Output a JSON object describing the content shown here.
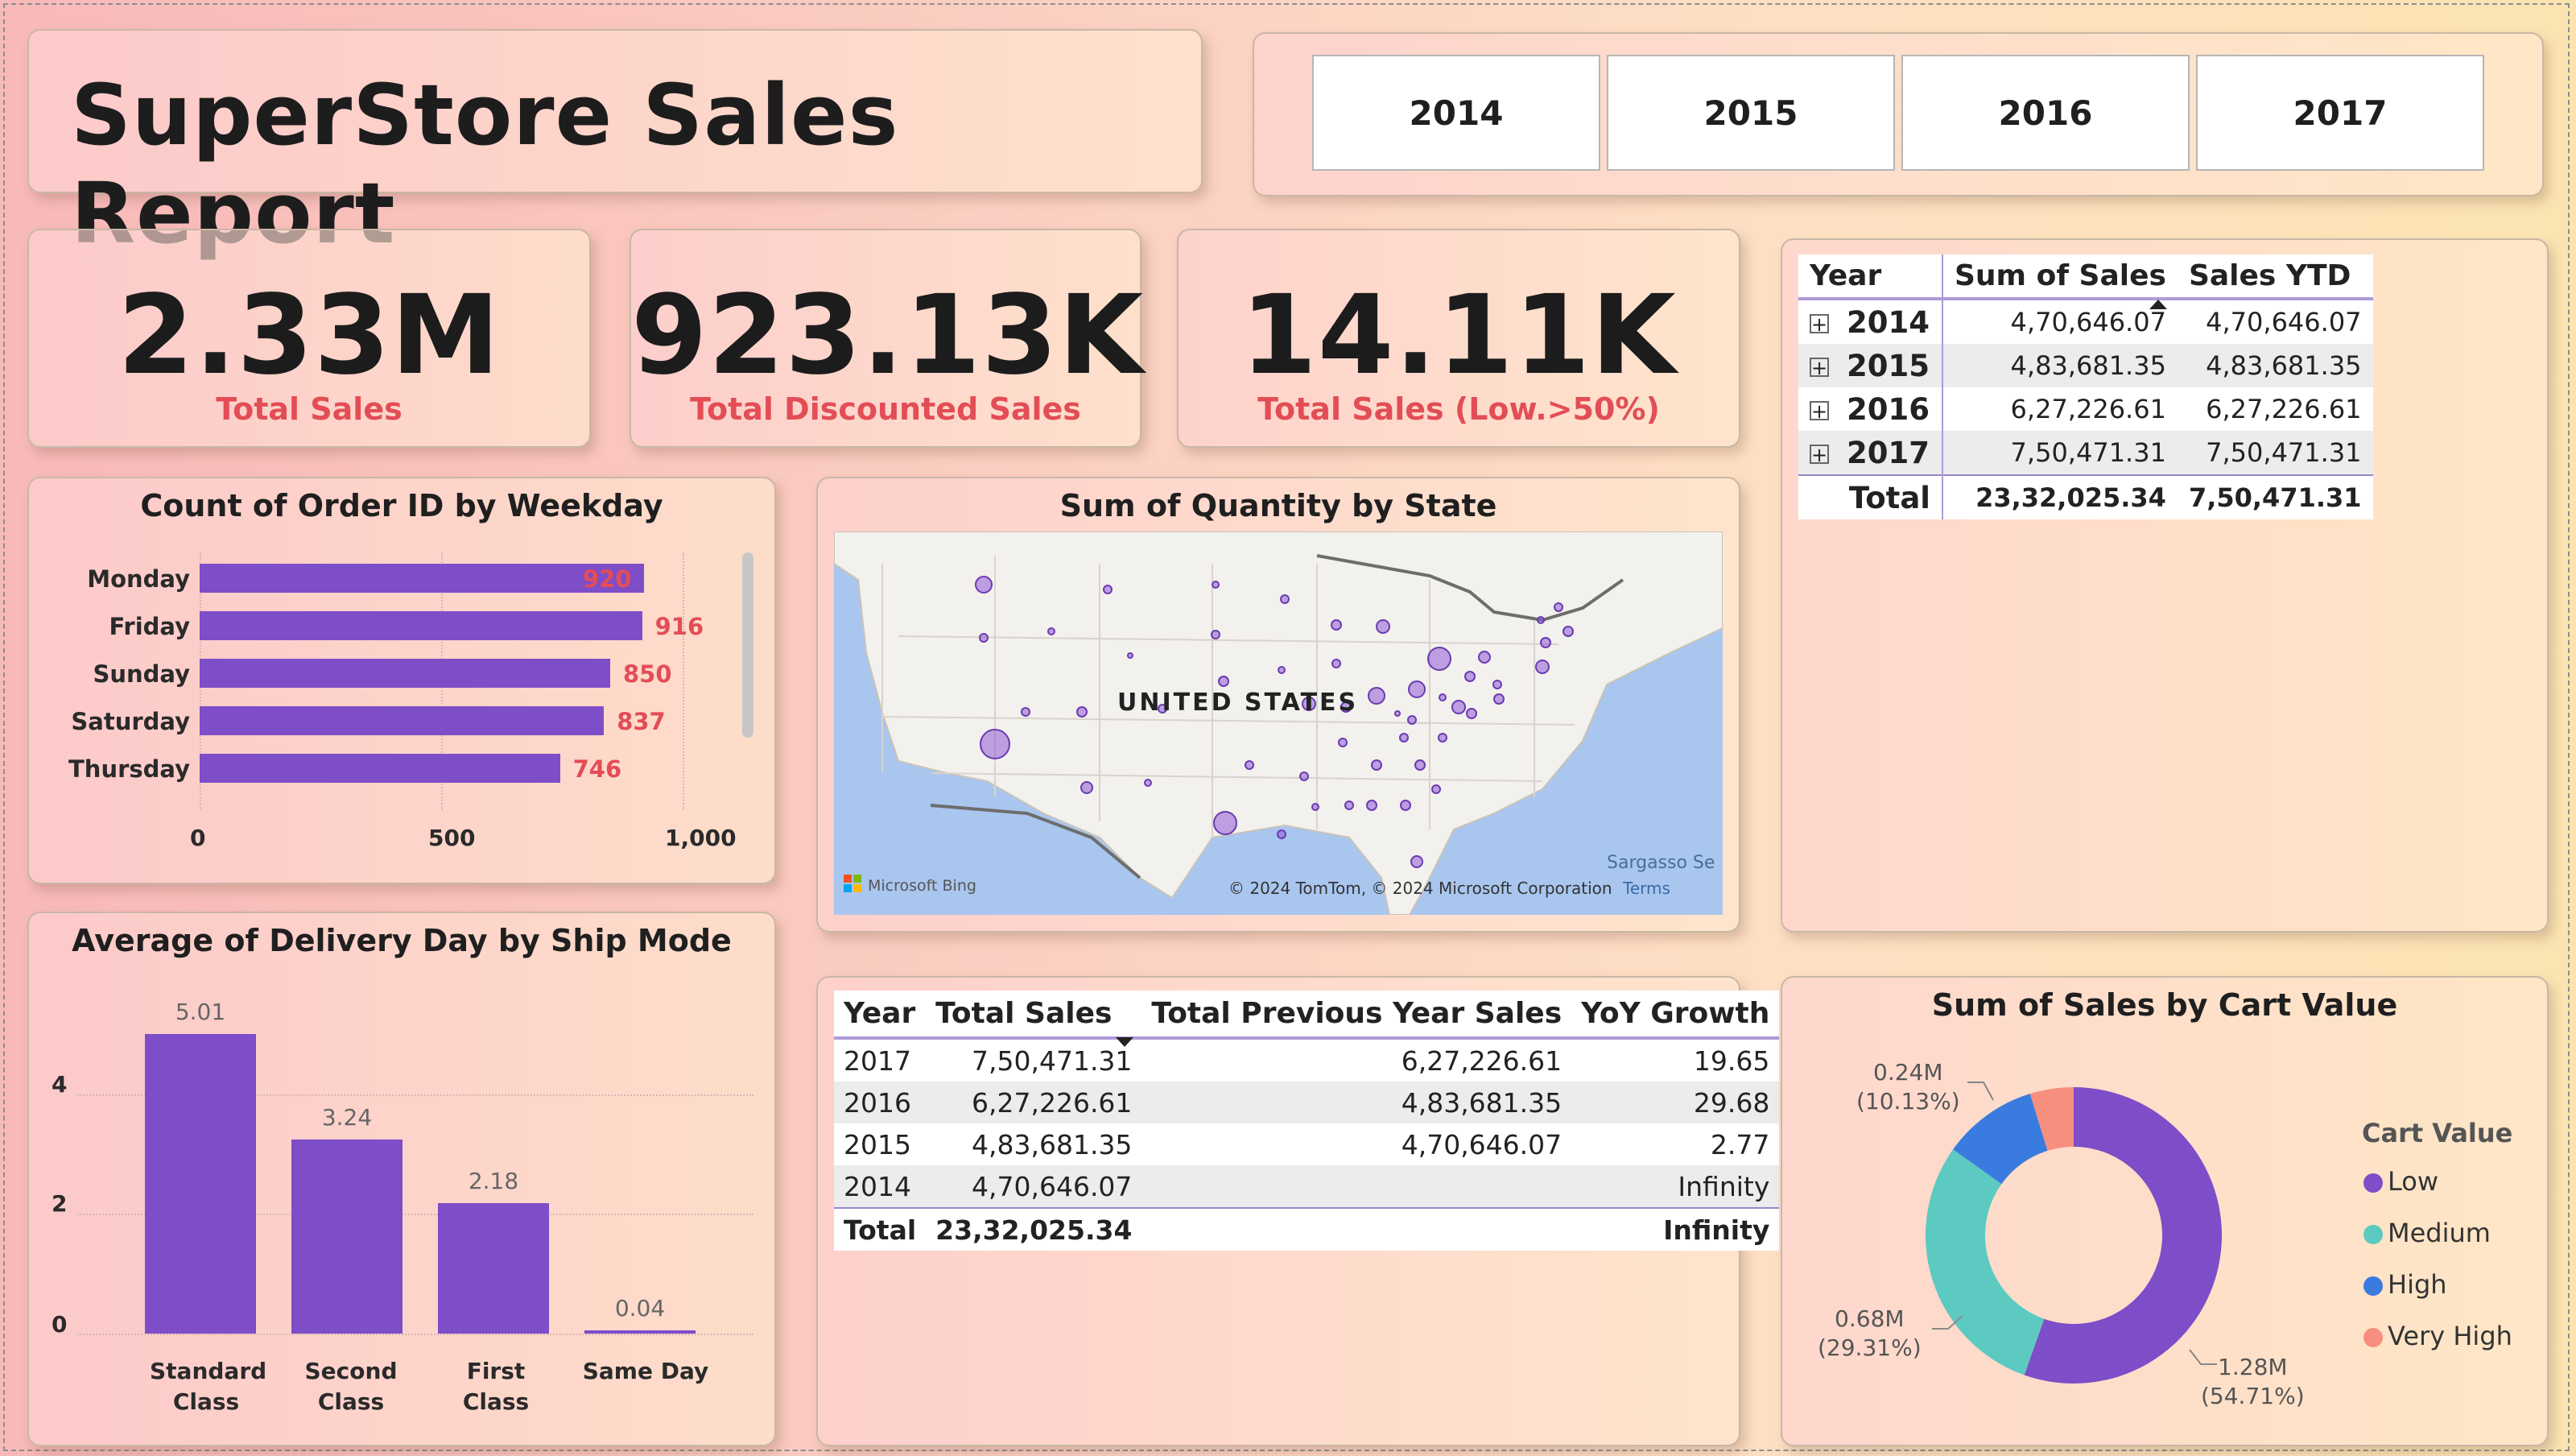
{
  "header": {
    "title": "SuperStore Sales Report"
  },
  "slicer": {
    "years": [
      "2014",
      "2015",
      "2016",
      "2017"
    ]
  },
  "kpis": [
    {
      "value": "2.33M",
      "label": "Total Sales"
    },
    {
      "value": "923.13K",
      "label": "Total Discounted Sales"
    },
    {
      "value": "14.11K",
      "label": "Total Sales (Low.>50%)"
    }
  ],
  "weekday_chart": {
    "title": "Count of Order ID by Weekday",
    "ticks": [
      "0",
      "500",
      "1,000"
    ]
  },
  "map": {
    "title": "Sum of Quantity by State",
    "country_label": "UNITED STATES",
    "bing": "Microsoft Bing",
    "sea_label": "Sargasso Se",
    "copyright": "© 2024 TomTom, © 2024 Microsoft Corporation",
    "terms": "Terms"
  },
  "delivery_chart": {
    "title": "Average of Delivery Day by Ship Mode",
    "yticks": [
      "0",
      "2",
      "4"
    ],
    "categories": [
      [
        "Standard",
        "Class"
      ],
      [
        "Second",
        "Class"
      ],
      [
        "First Class"
      ],
      [
        "Same Day"
      ]
    ]
  },
  "ytd_matrix": {
    "headers": [
      "Year",
      "Sum of Sales",
      "Sales YTD"
    ],
    "rows": [
      {
        "year": "2014",
        "sales": "4,70,646.07",
        "ytd": "4,70,646.07"
      },
      {
        "year": "2015",
        "sales": "4,83,681.35",
        "ytd": "4,83,681.35"
      },
      {
        "year": "2016",
        "sales": "6,27,226.61",
        "ytd": "6,27,226.61"
      },
      {
        "year": "2017",
        "sales": "7,50,471.31",
        "ytd": "7,50,471.31"
      }
    ],
    "total": {
      "label": "Total",
      "sales": "23,32,025.34",
      "ytd": "7,50,471.31"
    }
  },
  "yoy_table": {
    "headers": [
      "Year",
      "Total Sales",
      "Total Previous Year Sales",
      "YoY Growth"
    ],
    "rows": [
      {
        "year": "2017",
        "sales": "7,50,471.31",
        "prev": "6,27,226.61",
        "growth": "19.65"
      },
      {
        "year": "2016",
        "sales": "6,27,226.61",
        "prev": "4,83,681.35",
        "growth": "29.68"
      },
      {
        "year": "2015",
        "sales": "4,83,681.35",
        "prev": "4,70,646.07",
        "growth": "2.77"
      },
      {
        "year": "2014",
        "sales": "4,70,646.07",
        "prev": "",
        "growth": "Infinity"
      }
    ],
    "total": {
      "label": "Total",
      "sales": "23,32,025.34",
      "prev": "",
      "growth": "Infinity"
    }
  },
  "cart_chart": {
    "title": "Sum of Sales by Cart Value",
    "legend_title": "Cart Value"
  },
  "colors": {
    "bar": "#7e4dc8",
    "accent_red": "#e34d56",
    "medium": "#5ccac0",
    "high": "#3a7be0",
    "very_high": "#f78f7e",
    "map_water": "#a9c6ef",
    "map_land": "#f3f1ed"
  },
  "chart_data": [
    {
      "type": "bar",
      "title": "Count of Order ID by Weekday",
      "orientation": "horizontal",
      "categories": [
        "Monday",
        "Friday",
        "Sunday",
        "Saturday",
        "Thursday"
      ],
      "values": [
        920,
        916,
        850,
        837,
        746
      ],
      "xlim": [
        0,
        1000
      ],
      "x_ticks": [
        0,
        500,
        1000
      ],
      "data_labels": [
        "920",
        "916",
        "850",
        "837",
        "746"
      ]
    },
    {
      "type": "bar",
      "title": "Average of Delivery Day by Ship Mode",
      "categories": [
        "Standard Class",
        "Second Class",
        "First Class",
        "Same Day"
      ],
      "values": [
        5.01,
        3.24,
        2.18,
        0.04
      ],
      "data_labels": [
        "5.01",
        "3.24",
        "2.18",
        "0.04"
      ],
      "ylim": [
        0,
        5.01
      ],
      "y_ticks": [
        0,
        2,
        4
      ]
    },
    {
      "type": "pie",
      "title": "Sum of Sales by Cart Value",
      "donut": true,
      "legend_title": "Cart Value",
      "legend_position": "right",
      "slices": [
        {
          "name": "Low",
          "value": 1.28,
          "label": "1.28M",
          "percent": "(54.71%)",
          "color": "#7e4dc8"
        },
        {
          "name": "Medium",
          "value": 0.68,
          "label": "0.68M",
          "percent": "(29.31%)",
          "color": "#5ccac0"
        },
        {
          "name": "High",
          "value": 0.24,
          "label": "0.24M",
          "percent": "(10.13%)",
          "color": "#3a7be0"
        },
        {
          "name": "Very High",
          "value": 0.11,
          "label": "",
          "percent": "",
          "color": "#f78f7e"
        }
      ]
    }
  ]
}
